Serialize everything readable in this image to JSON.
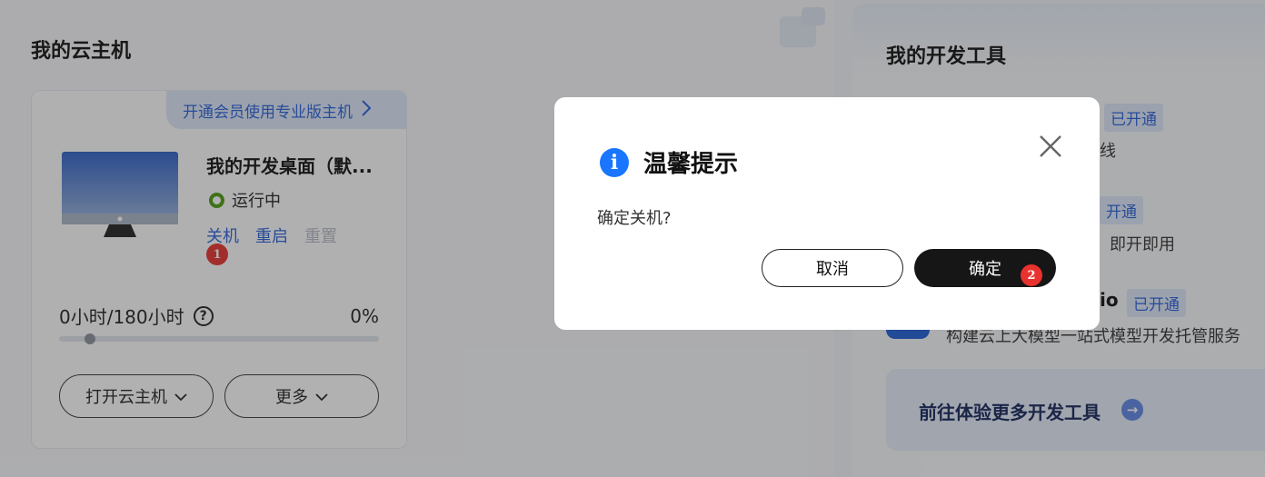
{
  "vm_panel": {
    "title": "我的云主机",
    "vip_banner": "开通会员使用专业版主机",
    "vm_name": "我的开发桌面（默...",
    "status": "运行中",
    "actions": {
      "shutdown": "关机",
      "restart": "重启",
      "reset": "重置"
    },
    "usage_text": "0小时/180小时",
    "usage_percent": "0%",
    "usage_fraction": 0,
    "open_button": "打开云主机",
    "more_button": "更多"
  },
  "dev_panel": {
    "title": "我的开发工具",
    "tags": {
      "t1": "已开通",
      "t2": "开通",
      "t3": "已开通"
    },
    "text_1": "线",
    "text_2": "即开即用",
    "text_3": "io",
    "text_4": "构建云上大模型一站式模型开发托管服务",
    "more_tools": "前往体验更多开发工具"
  },
  "modal": {
    "title": "温馨提示",
    "message": "确定关机?",
    "cancel_label": "取消",
    "confirm_label": "确定"
  },
  "markers": {
    "m1": "1",
    "m2": "2"
  },
  "colors": {
    "accent": "#2b62d8",
    "primary_button": "#161616",
    "status_green": "#4e9d13",
    "marker_red": "#e8322e",
    "info_blue": "#1a75ff"
  }
}
